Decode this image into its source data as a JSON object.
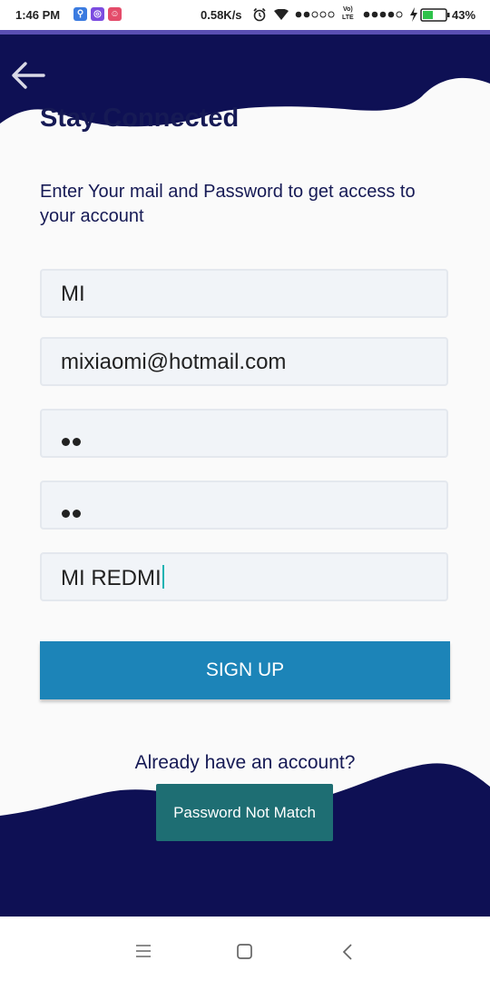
{
  "status_bar": {
    "time": "1:46 PM",
    "net_speed": "0.58K/s",
    "battery": "43%",
    "volte_top": "Vo)",
    "volte_bottom": "LTE"
  },
  "screen": {
    "title": "Stay Connected",
    "subtitle": "Enter Your mail and Password to get access to your account"
  },
  "form": {
    "name_value": "MI",
    "email_value": "mixiaomi@hotmail.com",
    "password_dots": 2,
    "confirm_dots": 2,
    "device_value": "MI REDMI"
  },
  "signup_label": "SIGN UP",
  "login_prompt": "Already have an account?",
  "toast": "Password Not Match",
  "colors": {
    "navy": "#0e1054",
    "button": "#1c84b8",
    "toast": "#1e6e73",
    "field_bg": "#f1f4f8"
  },
  "icons": [
    "back-arrow-icon",
    "menu-icon",
    "home-icon",
    "back-icon",
    "wifi-icon",
    "alarm-icon",
    "battery-icon"
  ]
}
